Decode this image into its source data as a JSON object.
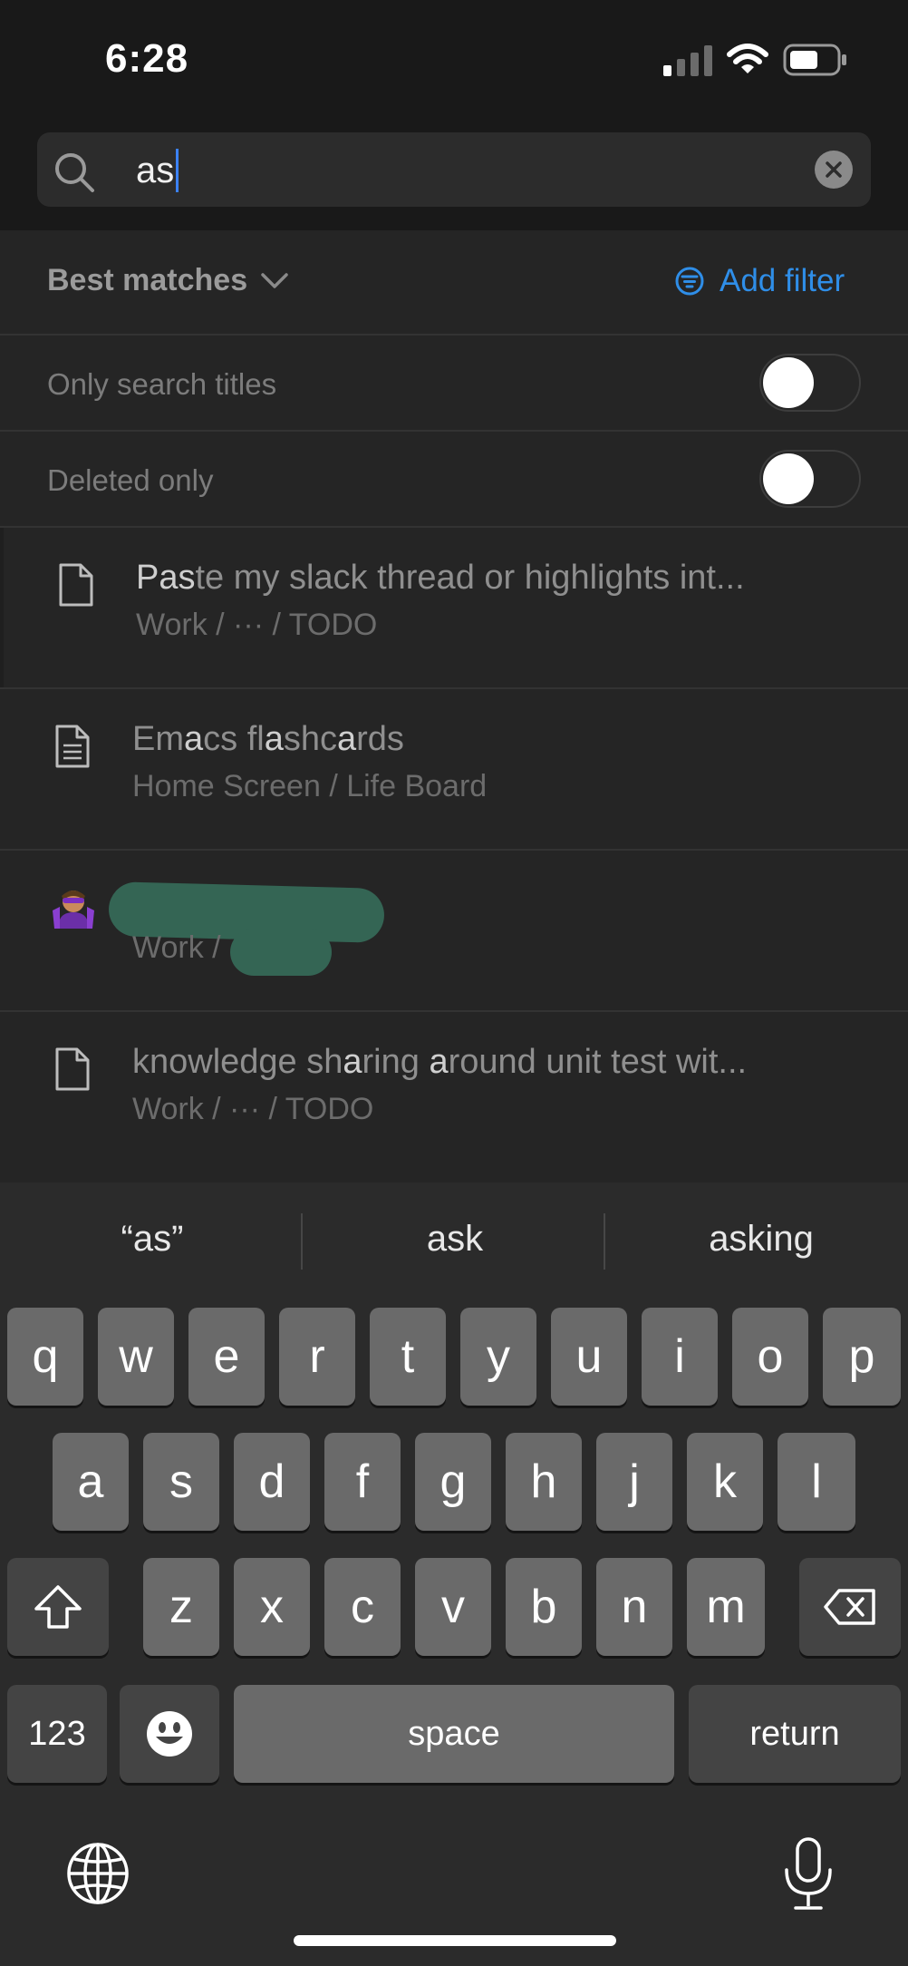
{
  "status": {
    "time": "6:28"
  },
  "search": {
    "query": "as"
  },
  "filters": {
    "sort_label": "Best matches",
    "add_filter_label": "Add filter",
    "toggles": [
      {
        "label": "Only search titles",
        "on": false
      },
      {
        "label": "Deleted only",
        "on": false
      }
    ]
  },
  "results": [
    {
      "title_match": "Pas",
      "title_rest": "te my slack thread or highlights int...",
      "path": "Work / ··· / TODO",
      "icon": "page-icon"
    },
    {
      "title_a": "Em",
      "title_b": "a",
      "title_c": "cs fl",
      "title_d": "a",
      "title_e": "shc",
      "title_f": "a",
      "title_g": "rds",
      "path": "Home Screen / Life Board",
      "icon": "document-icon"
    },
    {
      "path_prefix": "Work /",
      "icon": "superhero-avatar-icon",
      "redacted": true
    },
    {
      "title_a": "knowledge sh",
      "title_b": "a",
      "title_c": "ring ",
      "title_d": "a",
      "title_e": "round unit test wit...",
      "path": "Work / ··· / TODO",
      "icon": "page-icon"
    }
  ],
  "keyboard": {
    "suggestions": [
      "“as”",
      "ask",
      "asking"
    ],
    "row1": [
      "q",
      "w",
      "e",
      "r",
      "t",
      "y",
      "u",
      "i",
      "o",
      "p"
    ],
    "row2": [
      "a",
      "s",
      "d",
      "f",
      "g",
      "h",
      "j",
      "k",
      "l"
    ],
    "row3": [
      "z",
      "x",
      "c",
      "v",
      "b",
      "n",
      "m"
    ],
    "numbers_label": "123",
    "space_label": "space",
    "return_label": "return"
  },
  "colors": {
    "accent": "#2f8ee8",
    "caret": "#3b82f6",
    "redaction": "#346554"
  }
}
